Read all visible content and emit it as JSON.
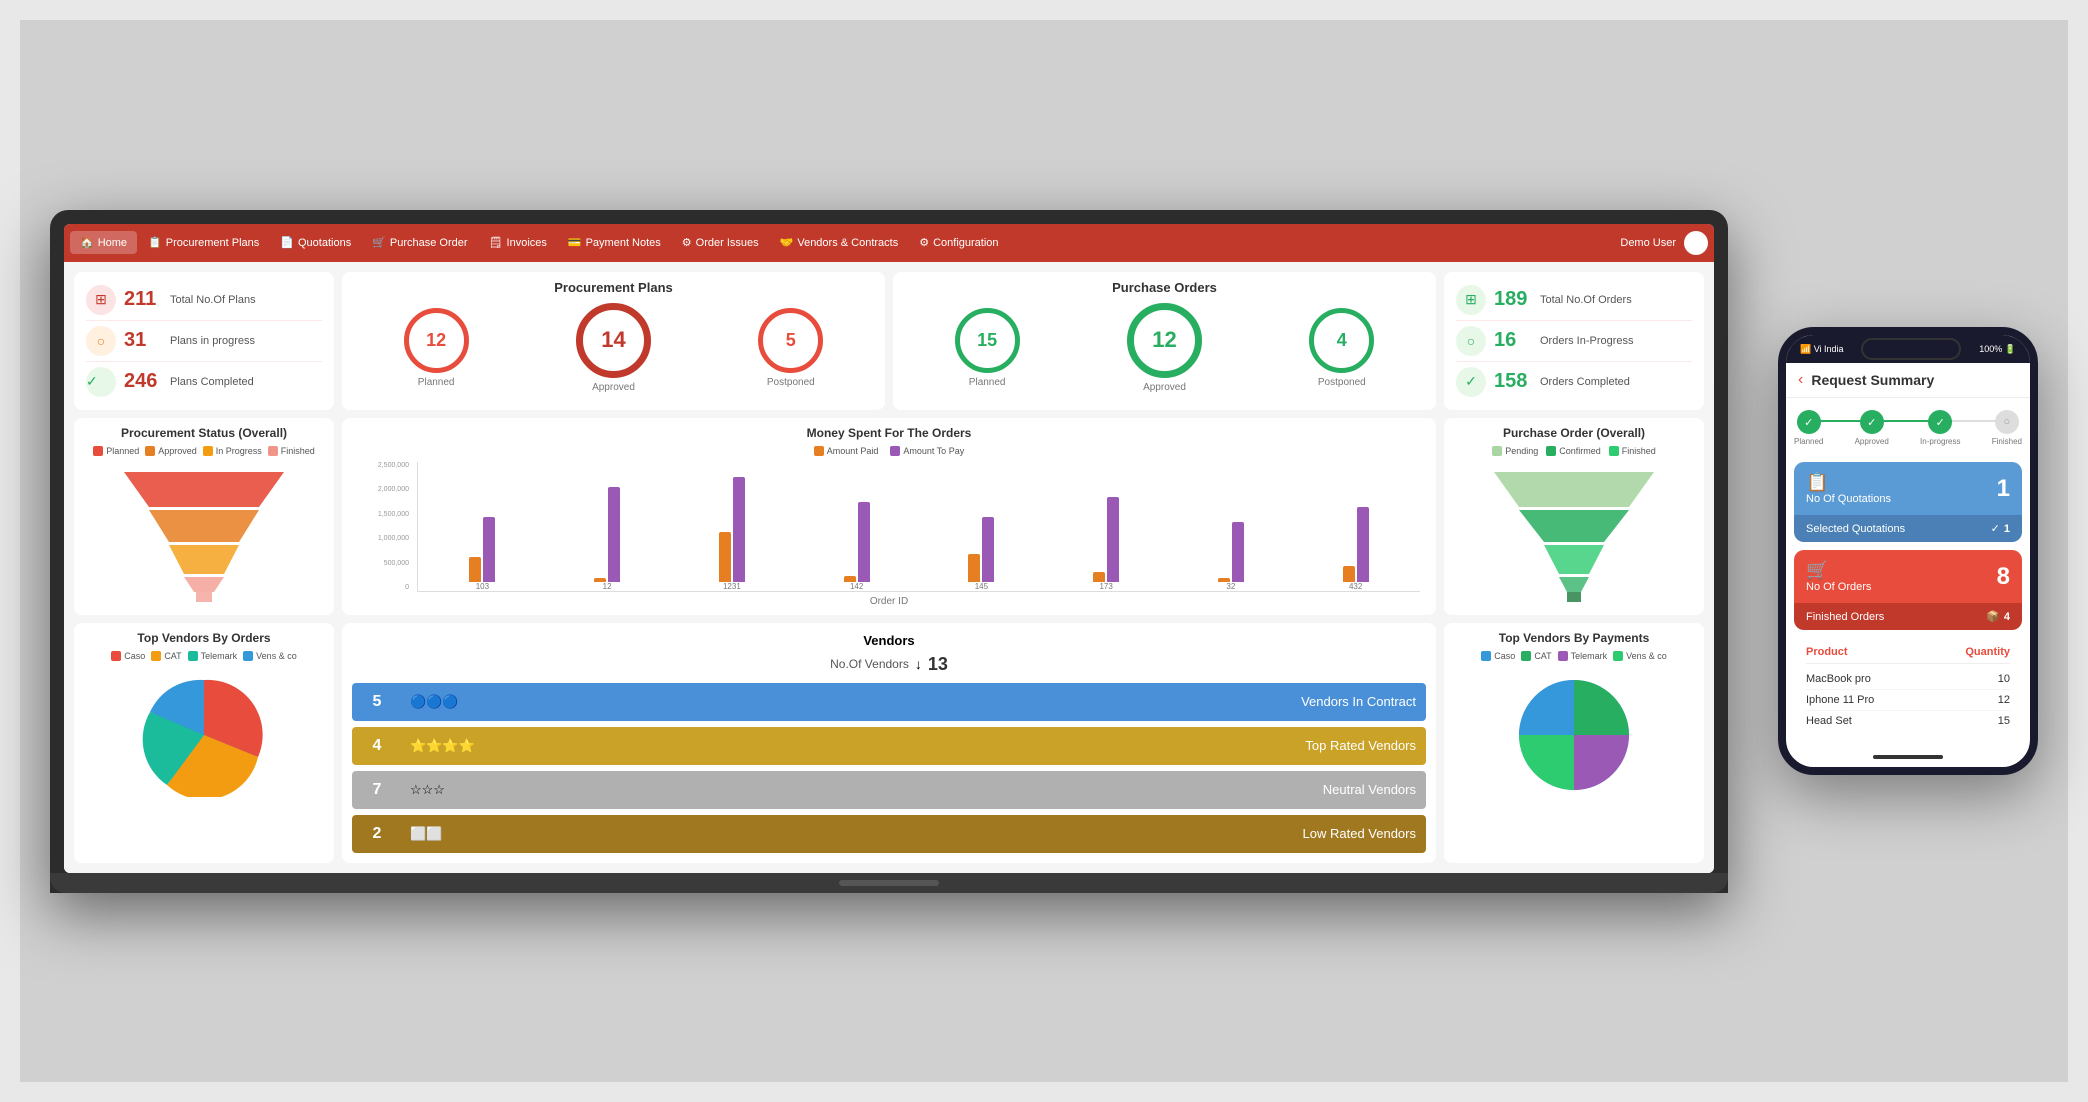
{
  "nav": {
    "items": [
      {
        "label": "Home",
        "active": true
      },
      {
        "label": "Procurement Plans"
      },
      {
        "label": "Quotations"
      },
      {
        "label": "Purchase Order"
      },
      {
        "label": "Invoices"
      },
      {
        "label": "Payment Notes"
      },
      {
        "label": "Order Issues"
      },
      {
        "label": "Vendors & Contracts"
      },
      {
        "label": "Configuration"
      }
    ],
    "user": "Demo User"
  },
  "procurement_plans": {
    "title": "Procurement Plans",
    "stats": [
      {
        "icon": "⊞",
        "number": "211",
        "label": "Total No.Of Plans",
        "color": "red"
      },
      {
        "icon": "○",
        "number": "31",
        "label": "Plans in progress",
        "color": "orange"
      },
      {
        "icon": "✓",
        "number": "246",
        "label": "Plans Completed",
        "color": "green"
      }
    ],
    "circles": [
      {
        "number": "12",
        "label": "Planned",
        "style": "red"
      },
      {
        "number": "14",
        "label": "Approved",
        "style": "red-bold"
      },
      {
        "number": "5",
        "label": "Postponed",
        "style": "red"
      }
    ]
  },
  "purchase_orders": {
    "title": "Purchase Orders",
    "circles": [
      {
        "number": "15",
        "label": "Planned",
        "style": "green"
      },
      {
        "number": "12",
        "label": "Approved",
        "style": "green-bold"
      },
      {
        "number": "4",
        "label": "Postponed",
        "style": "green"
      }
    ],
    "stats": [
      {
        "number": "189",
        "label": "Total No.Of Orders",
        "color": "green"
      },
      {
        "number": "16",
        "label": "Orders In-Progress",
        "color": "green"
      },
      {
        "number": "158",
        "label": "Orders Completed",
        "color": "green"
      }
    ]
  },
  "procurement_status": {
    "title": "Procurement Status (Overall)",
    "legend": [
      "Planned",
      "Approved",
      "In Progress",
      "Finished"
    ],
    "legend_colors": [
      "#e74c3c",
      "#e67e22",
      "#f39c12",
      "#f1948a"
    ]
  },
  "money_spent": {
    "title": "Money Spent For The Orders",
    "legend": [
      "Amount Paid",
      "Amount To Pay"
    ],
    "legend_colors": [
      "#e67e22",
      "#9b59b6"
    ],
    "y_labels": [
      "2,500,000",
      "2,000,000",
      "1,500,000",
      "1,000,000",
      "500,000",
      "0"
    ],
    "xlabel": "Order ID",
    "bars": [
      {
        "id": "103",
        "paid": 30,
        "topay": 80
      },
      {
        "id": "12",
        "paid": 5,
        "topay": 120
      },
      {
        "id": "1231",
        "paid": 65,
        "topay": 130
      },
      {
        "id": "142",
        "paid": 8,
        "topay": 100
      },
      {
        "id": "145",
        "paid": 35,
        "topay": 80
      },
      {
        "id": "173",
        "paid": 12,
        "topay": 105
      },
      {
        "id": "32",
        "paid": 5,
        "topay": 75
      },
      {
        "id": "432",
        "paid": 20,
        "topay": 95
      }
    ]
  },
  "purchase_order_overall": {
    "title": "Purchase Order (Overall)",
    "legend": [
      "Pending",
      "Confirmed",
      "Finished"
    ],
    "legend_colors": [
      "#a8d5a2",
      "#27ae60",
      "#2ecc71"
    ]
  },
  "top_vendors_orders": {
    "title": "Top Vendors By Orders",
    "legend": [
      "Caso",
      "CAT",
      "Telemark",
      "Vens & co"
    ],
    "legend_colors": [
      "#e74c3c",
      "#f39c12",
      "#1abc9c",
      "#3498db"
    ]
  },
  "vendors": {
    "title": "Vendors",
    "count_label": "No.Of Vendors",
    "count": "13",
    "rows": [
      {
        "count": "5",
        "label": "Vendors In Contract",
        "color": "blue"
      },
      {
        "count": "4",
        "label": "Top Rated Vendors",
        "color": "gold"
      },
      {
        "count": "7",
        "label": "Neutral Vendors",
        "color": "gray"
      },
      {
        "count": "2",
        "label": "Low Rated Vendors",
        "color": "dark-gold"
      }
    ]
  },
  "top_vendors_payments": {
    "title": "Top Vendors By Payments",
    "legend": [
      "Caso",
      "CAT",
      "Telemark",
      "Vens & co"
    ],
    "legend_colors": [
      "#3498db",
      "#27ae60",
      "#9b59b6",
      "#2ecc71"
    ]
  },
  "phone": {
    "title": "Request Summary",
    "steps": [
      "Planned",
      "Approved",
      "In-progress",
      "Finished"
    ],
    "quotations_label": "No Of Quotations",
    "quotations_count": "1",
    "selected_quotations_label": "Selected Quotations",
    "selected_quotations_count": "1",
    "orders_label": "No Of Orders",
    "orders_count": "8",
    "finished_orders_label": "Finished Orders",
    "finished_orders_count": "4",
    "product_label": "Product",
    "quantity_label": "Quantity",
    "products": [
      {
        "name": "MacBook pro",
        "qty": "10"
      },
      {
        "name": "Iphone 11 Pro",
        "qty": "12"
      },
      {
        "name": "Head Set",
        "qty": "15"
      }
    ]
  }
}
